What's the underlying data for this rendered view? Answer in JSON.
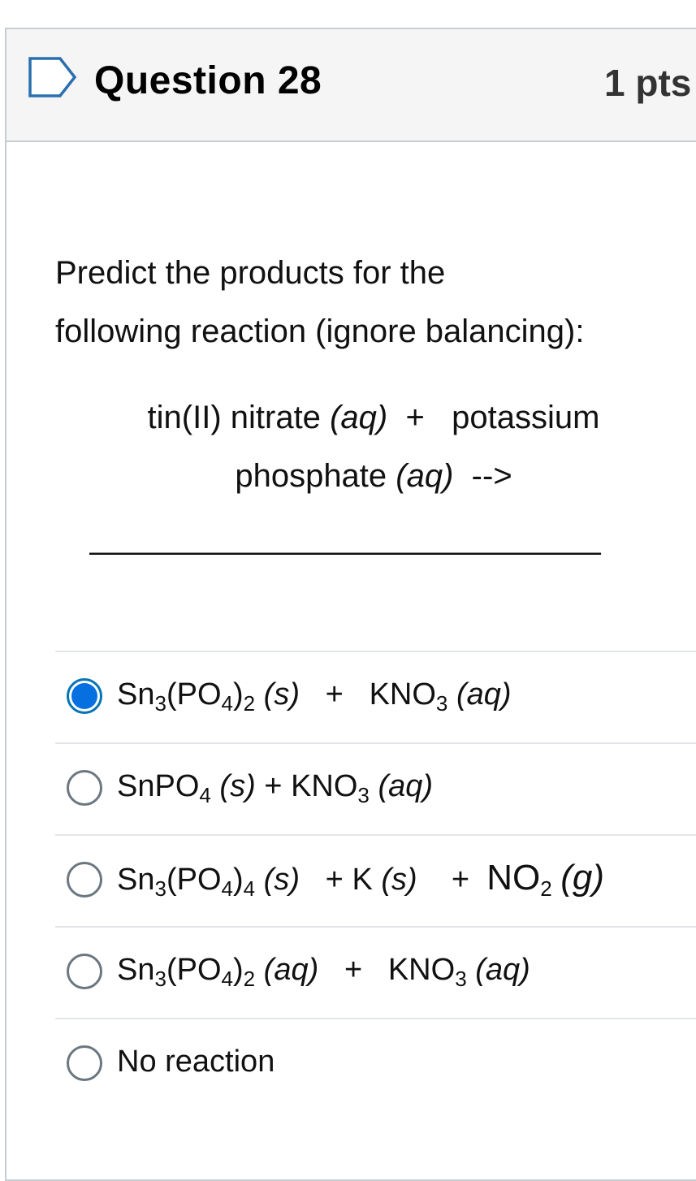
{
  "question": {
    "title": "Question 28",
    "points": "1 pts"
  },
  "prompt": {
    "line1": "Predict the products for the",
    "line2": "following reaction (ignore balancing):"
  },
  "reaction": {
    "reactant1": "tin(II) nitrate",
    "state1": "(aq)",
    "plus": "+",
    "reactant2a": "potassium",
    "reactant2b": "phosphate",
    "state2": "(aq)",
    "arrow": "-->",
    "blank": "_______________________________"
  },
  "answers": [
    {
      "selected": true,
      "parts": {
        "a": "Sn",
        "a_sub": "3",
        "b": "(PO",
        "b_sub": "4",
        "c": ")",
        "c_sub": "2",
        "s1": "(s)",
        "plus": "+",
        "d": "KNO",
        "d_sub": "3",
        "s2": "(aq)"
      }
    },
    {
      "selected": false,
      "parts": {
        "a": "SnPO",
        "a_sub": "4",
        "s1": "(s)",
        "plus": "+",
        "d": "KNO",
        "d_sub": "3",
        "s2": "(aq)"
      }
    },
    {
      "selected": false,
      "parts": {
        "a": "Sn",
        "a_sub": "3",
        "b": "(PO",
        "b_sub": "4",
        "c": ")",
        "c_sub": "4",
        "s1": "(s)",
        "plus": "+",
        "k": "K",
        "s2": "(s)",
        "plus2": "+",
        "d": "NO",
        "d_sub": "2",
        "s3": "(g)"
      }
    },
    {
      "selected": false,
      "parts": {
        "a": "Sn",
        "a_sub": "3",
        "b": "(PO",
        "b_sub": "4",
        "c": ")",
        "c_sub": "2",
        "s1": "(aq)",
        "plus": "+",
        "d": "KNO",
        "d_sub": "3",
        "s2": "(aq)"
      }
    },
    {
      "selected": false,
      "parts": {
        "text": "No reaction"
      }
    }
  ],
  "colors": {
    "selected_radio": "#0770e0",
    "header_bg": "#f5f5f5",
    "border": "#c7cdd1"
  }
}
